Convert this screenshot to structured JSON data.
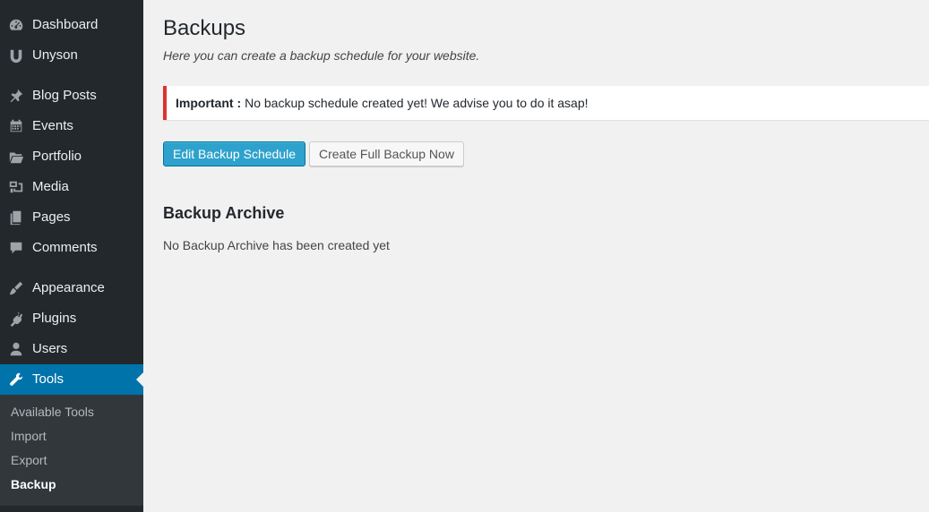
{
  "sidebar": {
    "groups": [
      [
        {
          "label": "Dashboard",
          "icon": "dashboard-icon"
        },
        {
          "label": "Unyson",
          "icon": "unyson-icon"
        }
      ],
      [
        {
          "label": "Blog Posts",
          "icon": "pin-icon"
        },
        {
          "label": "Events",
          "icon": "calendar-icon"
        },
        {
          "label": "Portfolio",
          "icon": "folder-icon"
        },
        {
          "label": "Media",
          "icon": "media-icon"
        },
        {
          "label": "Pages",
          "icon": "pages-icon"
        },
        {
          "label": "Comments",
          "icon": "comment-icon"
        }
      ],
      [
        {
          "label": "Appearance",
          "icon": "brush-icon"
        },
        {
          "label": "Plugins",
          "icon": "plug-icon"
        },
        {
          "label": "Users",
          "icon": "user-icon"
        },
        {
          "label": "Tools",
          "icon": "wrench-icon",
          "active": true
        }
      ]
    ],
    "submenu": [
      {
        "label": "Available Tools"
      },
      {
        "label": "Import"
      },
      {
        "label": "Export"
      },
      {
        "label": "Backup",
        "current": true
      }
    ],
    "colors": {
      "background": "#23282d",
      "active": "#0073aa",
      "submenu": "#32373c"
    }
  },
  "main": {
    "title": "Backups",
    "subtitle": "Here you can create a backup schedule for your website.",
    "notice": {
      "strong": "Important :",
      "text": "No backup schedule created yet! We advise you to do it asap!",
      "border_color": "#dc3232"
    },
    "buttons": {
      "edit_schedule": "Edit Backup Schedule",
      "create_full_backup": "Create Full Backup Now"
    },
    "archive": {
      "heading": "Backup Archive",
      "empty_text": "No Backup Archive has been created yet"
    }
  }
}
